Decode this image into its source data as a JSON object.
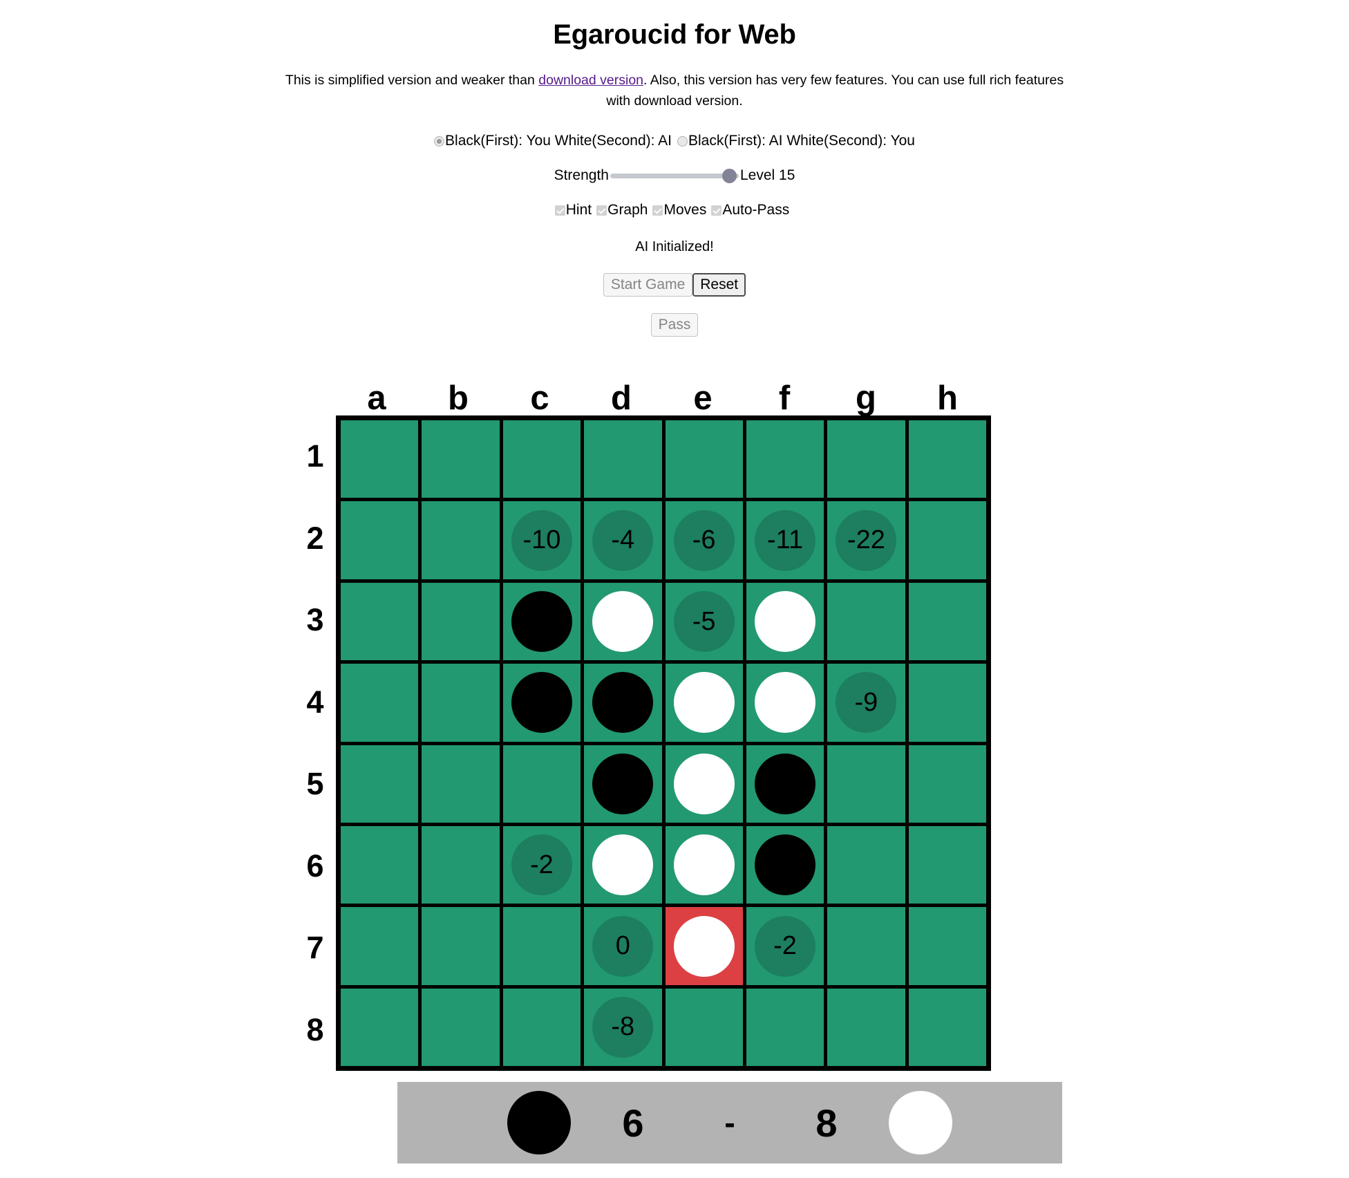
{
  "header": {
    "title": "Egaroucid for Web",
    "intro_before_link": "This is simplified version and weaker than ",
    "intro_link": "download version",
    "intro_after_link": ". Also, this version has very few features. You can use full rich features with download version."
  },
  "mode": {
    "option1_label": "Black(First): You White(Second): AI",
    "option1_checked": true,
    "option2_label": "Black(First): AI White(Second): You",
    "option2_checked": false
  },
  "strength": {
    "label": "Strength",
    "level_label": "Level 15",
    "level_value": 15,
    "min": 1,
    "max": 16
  },
  "toggles": [
    {
      "label": "Hint",
      "checked": true
    },
    {
      "label": "Graph",
      "checked": true
    },
    {
      "label": "Moves",
      "checked": true
    },
    {
      "label": "Auto-Pass",
      "checked": true
    }
  ],
  "status": {
    "text": "AI Initialized!"
  },
  "buttons": {
    "start_game": {
      "label": "Start Game",
      "enabled": false
    },
    "reset": {
      "label": "Reset",
      "enabled": true
    },
    "pass": {
      "label": "Pass",
      "enabled": false
    }
  },
  "board": {
    "columns": [
      "a",
      "b",
      "c",
      "d",
      "e",
      "f",
      "g",
      "h"
    ],
    "rows": [
      "1",
      "2",
      "3",
      "4",
      "5",
      "6",
      "7",
      "8"
    ],
    "cell_color": "#229970",
    "hint_color": "#1d7f5f",
    "last_move_color": "#dc4043",
    "last_move": "e7",
    "cells": [
      [
        {
          "state": "empty"
        },
        {
          "state": "empty"
        },
        {
          "state": "empty"
        },
        {
          "state": "empty"
        },
        {
          "state": "empty"
        },
        {
          "state": "empty"
        },
        {
          "state": "empty"
        },
        {
          "state": "empty"
        }
      ],
      [
        {
          "state": "empty"
        },
        {
          "state": "empty"
        },
        {
          "state": "hint",
          "value": "-10"
        },
        {
          "state": "hint",
          "value": "-4"
        },
        {
          "state": "hint",
          "value": "-6"
        },
        {
          "state": "hint",
          "value": "-11"
        },
        {
          "state": "hint",
          "value": "-22"
        },
        {
          "state": "empty"
        }
      ],
      [
        {
          "state": "empty"
        },
        {
          "state": "empty"
        },
        {
          "state": "black"
        },
        {
          "state": "white"
        },
        {
          "state": "hint",
          "value": "-5"
        },
        {
          "state": "white"
        },
        {
          "state": "empty"
        },
        {
          "state": "empty"
        }
      ],
      [
        {
          "state": "empty"
        },
        {
          "state": "empty"
        },
        {
          "state": "black"
        },
        {
          "state": "black"
        },
        {
          "state": "white"
        },
        {
          "state": "white"
        },
        {
          "state": "hint",
          "value": "-9"
        },
        {
          "state": "empty"
        }
      ],
      [
        {
          "state": "empty"
        },
        {
          "state": "empty"
        },
        {
          "state": "empty"
        },
        {
          "state": "black"
        },
        {
          "state": "white"
        },
        {
          "state": "black"
        },
        {
          "state": "empty"
        },
        {
          "state": "empty"
        }
      ],
      [
        {
          "state": "empty"
        },
        {
          "state": "empty"
        },
        {
          "state": "hint",
          "value": "-2"
        },
        {
          "state": "white"
        },
        {
          "state": "white"
        },
        {
          "state": "black"
        },
        {
          "state": "empty"
        },
        {
          "state": "empty"
        }
      ],
      [
        {
          "state": "empty"
        },
        {
          "state": "empty"
        },
        {
          "state": "empty"
        },
        {
          "state": "hint",
          "value": "0"
        },
        {
          "state": "white",
          "last_move": true
        },
        {
          "state": "hint",
          "value": "-2"
        },
        {
          "state": "empty"
        },
        {
          "state": "empty"
        }
      ],
      [
        {
          "state": "empty"
        },
        {
          "state": "empty"
        },
        {
          "state": "empty"
        },
        {
          "state": "hint",
          "value": "-8"
        },
        {
          "state": "empty"
        },
        {
          "state": "empty"
        },
        {
          "state": "empty"
        },
        {
          "state": "empty"
        }
      ]
    ]
  },
  "score": {
    "black": "6",
    "separator": "-",
    "white": "8"
  }
}
